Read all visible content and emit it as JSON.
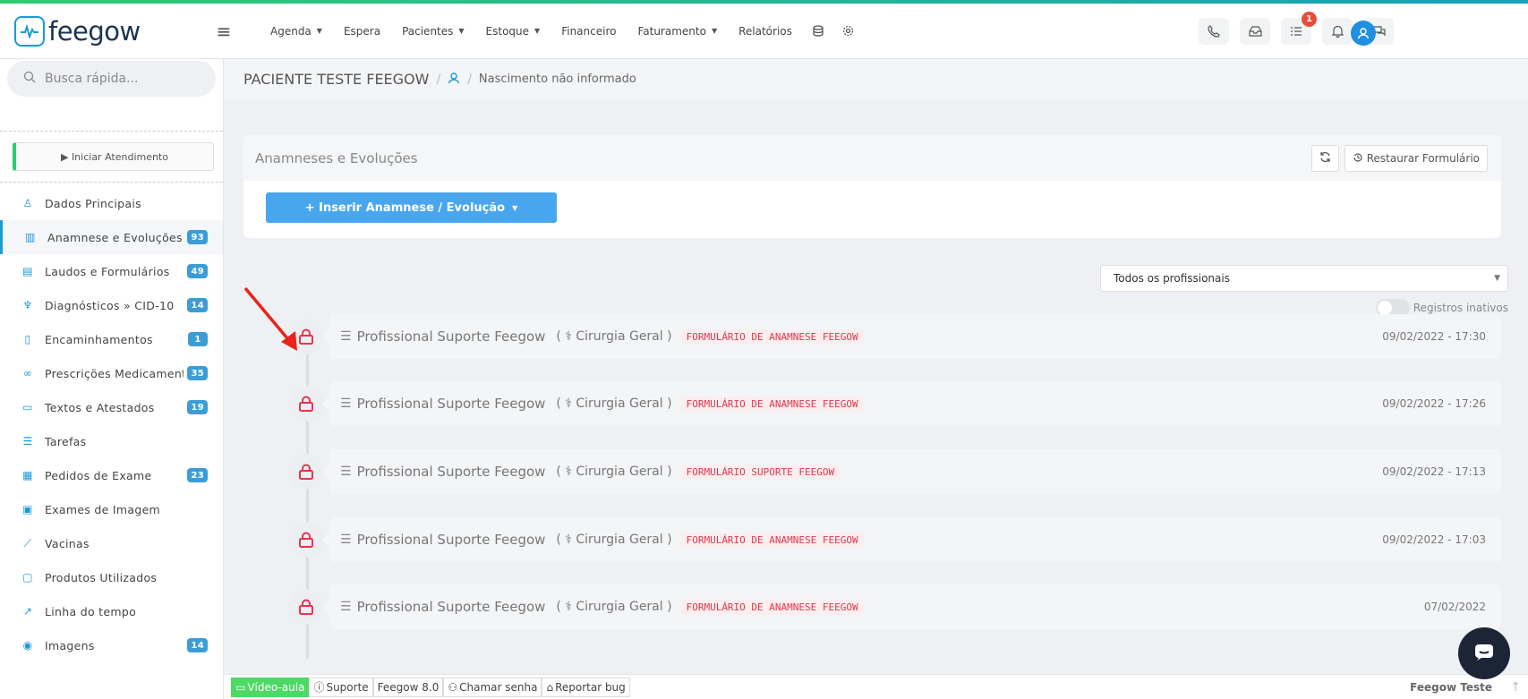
{
  "brand": {
    "name": "feegow"
  },
  "nav": {
    "items": [
      {
        "label": "Agenda",
        "caret": true
      },
      {
        "label": "Espera",
        "caret": false
      },
      {
        "label": "Pacientes",
        "caret": true
      },
      {
        "label": "Estoque",
        "caret": true
      },
      {
        "label": "Financeiro",
        "caret": false
      },
      {
        "label": "Faturamento",
        "caret": true
      },
      {
        "label": "Relatórios",
        "caret": false
      }
    ],
    "task_badge": "1"
  },
  "sidebar": {
    "search_placeholder": "Busca rápida...",
    "start_button": "▶ Iniciar Atendimento",
    "items": [
      {
        "label": "Dados Principais",
        "count": "",
        "icon": "user-icon"
      },
      {
        "label": "Anamnese e Evoluções",
        "count": "93",
        "icon": "chart-icon"
      },
      {
        "label": "Laudos e Formulários",
        "count": "49",
        "icon": "clipboard-icon"
      },
      {
        "label": "Diagnósticos » CID-10",
        "count": "14",
        "icon": "stethoscope-icon"
      },
      {
        "label": "Encaminhamentos",
        "count": "1",
        "icon": "document-icon"
      },
      {
        "label": "Prescrições Medicamentosas",
        "count": "35",
        "icon": "pills-icon"
      },
      {
        "label": "Textos e Atestados",
        "count": "19",
        "icon": "text-document-icon"
      },
      {
        "label": "Tarefas",
        "count": "",
        "icon": "tasks-icon"
      },
      {
        "label": "Pedidos de Exame",
        "count": "23",
        "icon": "hospital-icon"
      },
      {
        "label": "Exames de Imagem",
        "count": "",
        "icon": "image-exam-icon"
      },
      {
        "label": "Vacinas",
        "count": "",
        "icon": "syringe-icon"
      },
      {
        "label": "Produtos Utilizados",
        "count": "",
        "icon": "box-icon"
      },
      {
        "label": "Linha do tempo",
        "count": "",
        "icon": "timeline-icon"
      },
      {
        "label": "Imagens",
        "count": "14",
        "icon": "camera-icon"
      }
    ]
  },
  "breadcrumb": {
    "patient": "PACIENTE TESTE FEEGOW",
    "separator": "/",
    "birth": "Nascimento não informado"
  },
  "card": {
    "title": "Anamneses e Evoluções",
    "restore_label": "Restaurar Formulário",
    "insert_label": "+ Inserir Anamnese / Evolução"
  },
  "filters": {
    "professional": "Todos os profissionais",
    "inactive_label": "Registros inativos"
  },
  "entries": [
    {
      "professional": "Profissional Suporte Feegow",
      "specialty": "( ⚕ Cirurgia Geral )",
      "form": "FORMULÁRIO DE ANAMNESE FEEGOW",
      "date": "09/02/2022 - 17:30"
    },
    {
      "professional": "Profissional Suporte Feegow",
      "specialty": "( ⚕ Cirurgia Geral )",
      "form": "FORMULÁRIO DE ANAMNESE FEEGOW",
      "date": "09/02/2022 - 17:26"
    },
    {
      "professional": "Profissional Suporte Feegow",
      "specialty": "( ⚕ Cirurgia Geral )",
      "form": "FORMULÁRIO SUPORTE FEEGOW",
      "date": "09/02/2022 - 17:13"
    },
    {
      "professional": "Profissional Suporte Feegow",
      "specialty": "( ⚕ Cirurgia Geral )",
      "form": "FORMULÁRIO DE ANAMNESE FEEGOW",
      "date": "09/02/2022 - 17:03"
    },
    {
      "professional": "Profissional Suporte Feegow",
      "specialty": "( ⚕ Cirurgia Geral )",
      "form": "FORMULÁRIO DE ANAMNESE FEEGOW",
      "date": "07/02/2022"
    }
  ],
  "footer": {
    "video": "Vídeo-aula",
    "support": "Suporte",
    "version": "Feegow 8.0",
    "call": "Chamar senha",
    "bug": "Reportar bug",
    "user": "Feegow Teste"
  },
  "colors": {
    "accent": "#1b9ad6",
    "insert_button": "#48a6ee",
    "lock": "#e3364d",
    "video_button": "#4cd964"
  }
}
